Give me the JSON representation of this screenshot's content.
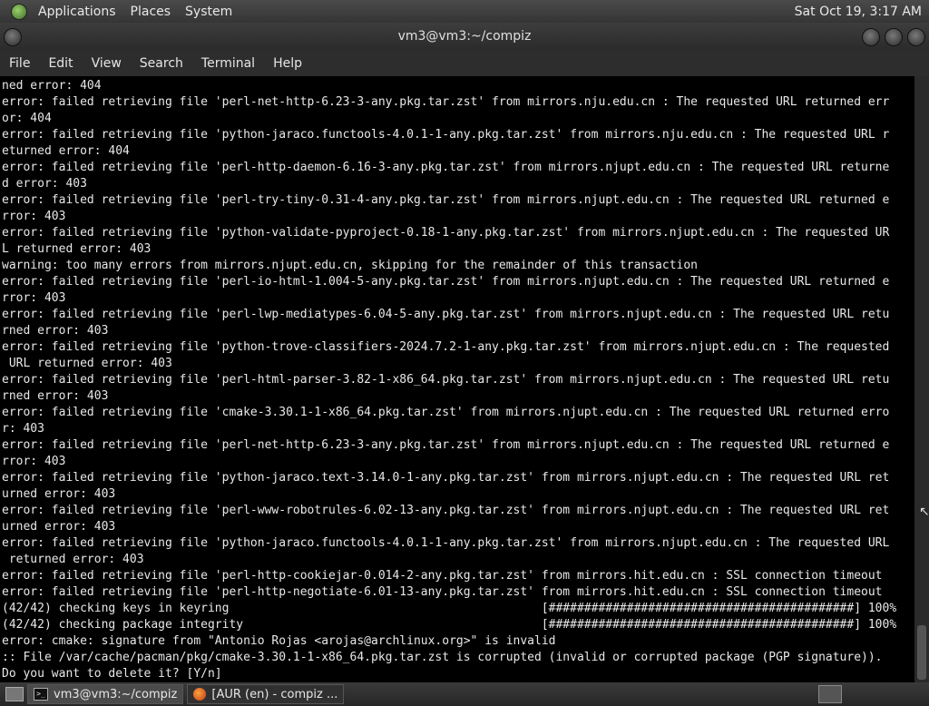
{
  "top_panel": {
    "menus": [
      "Applications",
      "Places",
      "System"
    ],
    "clock": "Sat Oct 19,  3:17 AM"
  },
  "window": {
    "title": "vm3@vm3:~/compiz"
  },
  "menubar": [
    "File",
    "Edit",
    "View",
    "Search",
    "Terminal",
    "Help"
  ],
  "terminal": {
    "lines": [
      "ned error: 404",
      "error: failed retrieving file 'perl-net-http-6.23-3-any.pkg.tar.zst' from mirrors.nju.edu.cn : The requested URL returned err",
      "or: 404",
      "error: failed retrieving file 'python-jaraco.functools-4.0.1-1-any.pkg.tar.zst' from mirrors.nju.edu.cn : The requested URL r",
      "eturned error: 404",
      "error: failed retrieving file 'perl-http-daemon-6.16-3-any.pkg.tar.zst' from mirrors.njupt.edu.cn : The requested URL returne",
      "d error: 403",
      "error: failed retrieving file 'perl-try-tiny-0.31-4-any.pkg.tar.zst' from mirrors.njupt.edu.cn : The requested URL returned e",
      "rror: 403",
      "error: failed retrieving file 'python-validate-pyproject-0.18-1-any.pkg.tar.zst' from mirrors.njupt.edu.cn : The requested UR",
      "L returned error: 403",
      "warning: too many errors from mirrors.njupt.edu.cn, skipping for the remainder of this transaction",
      "error: failed retrieving file 'perl-io-html-1.004-5-any.pkg.tar.zst' from mirrors.njupt.edu.cn : The requested URL returned e",
      "rror: 403",
      "error: failed retrieving file 'perl-lwp-mediatypes-6.04-5-any.pkg.tar.zst' from mirrors.njupt.edu.cn : The requested URL retu",
      "rned error: 403",
      "error: failed retrieving file 'python-trove-classifiers-2024.7.2-1-any.pkg.tar.zst' from mirrors.njupt.edu.cn : The requested",
      " URL returned error: 403",
      "error: failed retrieving file 'perl-html-parser-3.82-1-x86_64.pkg.tar.zst' from mirrors.njupt.edu.cn : The requested URL retu",
      "rned error: 403",
      "error: failed retrieving file 'cmake-3.30.1-1-x86_64.pkg.tar.zst' from mirrors.njupt.edu.cn : The requested URL returned erro",
      "r: 403",
      "error: failed retrieving file 'perl-net-http-6.23-3-any.pkg.tar.zst' from mirrors.njupt.edu.cn : The requested URL returned e",
      "rror: 403",
      "error: failed retrieving file 'python-jaraco.text-3.14.0-1-any.pkg.tar.zst' from mirrors.njupt.edu.cn : The requested URL ret",
      "urned error: 403",
      "error: failed retrieving file 'perl-www-robotrules-6.02-13-any.pkg.tar.zst' from mirrors.njupt.edu.cn : The requested URL ret",
      "urned error: 403",
      "error: failed retrieving file 'python-jaraco.functools-4.0.1-1-any.pkg.tar.zst' from mirrors.njupt.edu.cn : The requested URL",
      " returned error: 403",
      "error: failed retrieving file 'perl-http-cookiejar-0.014-2-any.pkg.tar.zst' from mirrors.hit.edu.cn : SSL connection timeout",
      "error: failed retrieving file 'perl-http-negotiate-6.01-13-any.pkg.tar.zst' from mirrors.hit.edu.cn : SSL connection timeout",
      "(42/42) checking keys in keyring                                            [###########################################] 100%",
      "(42/42) checking package integrity                                          [###########################################] 100%",
      "error: cmake: signature from \"Antonio Rojas <arojas@archlinux.org>\" is invalid",
      ":: File /var/cache/pacman/pkg/cmake-3.30.1-1-x86_64.pkg.tar.zst is corrupted (invalid or corrupted package (PGP signature)).",
      "Do you want to delete it? [Y/n]"
    ]
  },
  "taskbar": {
    "tasks": [
      "vm3@vm3:~/compiz",
      "[AUR (en) - compiz ..."
    ]
  }
}
